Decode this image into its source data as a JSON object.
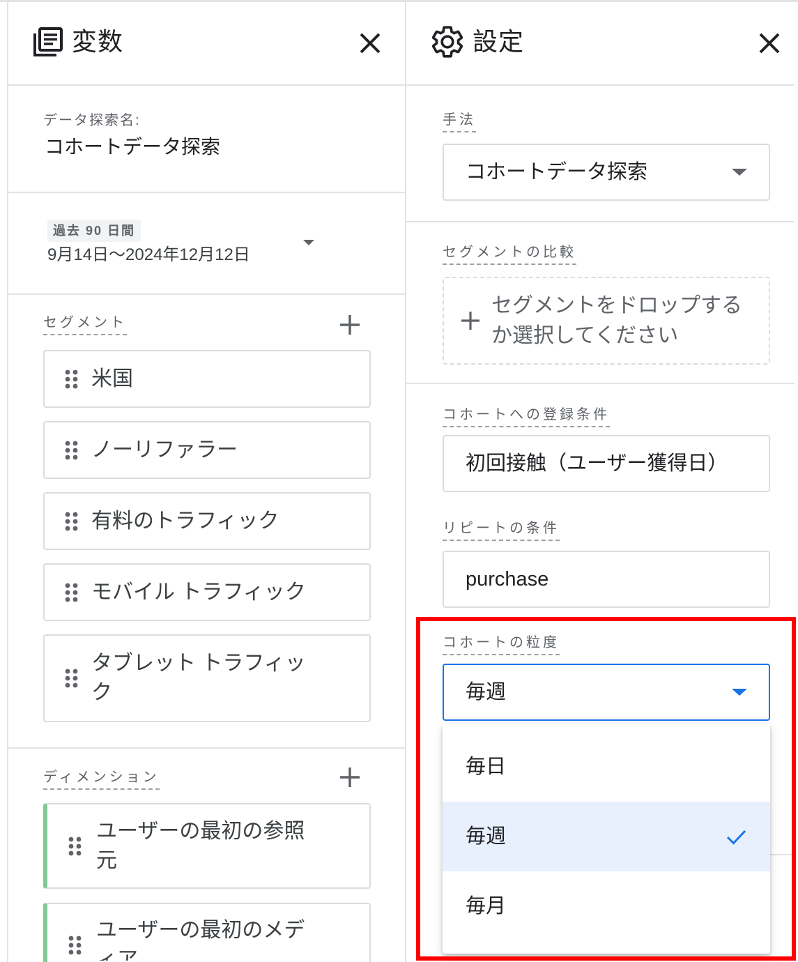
{
  "variables_panel": {
    "title": "変数",
    "exploration_name": {
      "label": "データ探索名:",
      "value": "コホートデータ探索"
    },
    "date_range": {
      "preset": "過去 90 日間",
      "range": "9月14日～2024年12月12日"
    },
    "segments": {
      "label": "セグメント",
      "items": [
        "米国",
        "ノーリファラー",
        "有料のトラフィック",
        "モバイル トラフィック",
        "タブレット トラフィック"
      ]
    },
    "dimensions": {
      "label": "ディメンション",
      "items": [
        "ユーザーの最初の参照元",
        "ユーザーの最初のメディア"
      ]
    }
  },
  "settings_panel": {
    "title": "設定",
    "technique": {
      "label": "手法",
      "value": "コホートデータ探索"
    },
    "segment_comparison": {
      "label": "セグメントの比較",
      "placeholder": "セグメントをドロップするか選択してください"
    },
    "cohort_inclusion": {
      "label": "コホートへの登録条件",
      "value": "初回接触（ユーザー獲得日）"
    },
    "return_criteria": {
      "label": "リピートの条件",
      "value": "purchase"
    },
    "cohort_granularity": {
      "label": "コホートの粒度",
      "value": "毎週",
      "options": [
        {
          "label": "毎日",
          "selected": false
        },
        {
          "label": "毎週",
          "selected": true
        },
        {
          "label": "毎月",
          "selected": false
        }
      ]
    }
  },
  "icons": {
    "variables": "variables-icon",
    "settings": "gear-icon",
    "close": "close-icon",
    "add": "plus-icon",
    "drag": "drag-handle-icon",
    "dropdown": "caret-down-icon",
    "selected": "check-icon"
  },
  "colors": {
    "accent": "#1a73e8",
    "selected_option_bg": "#e8f0fe",
    "dimension_accent": "#81c995",
    "highlight": "#ff0000"
  }
}
